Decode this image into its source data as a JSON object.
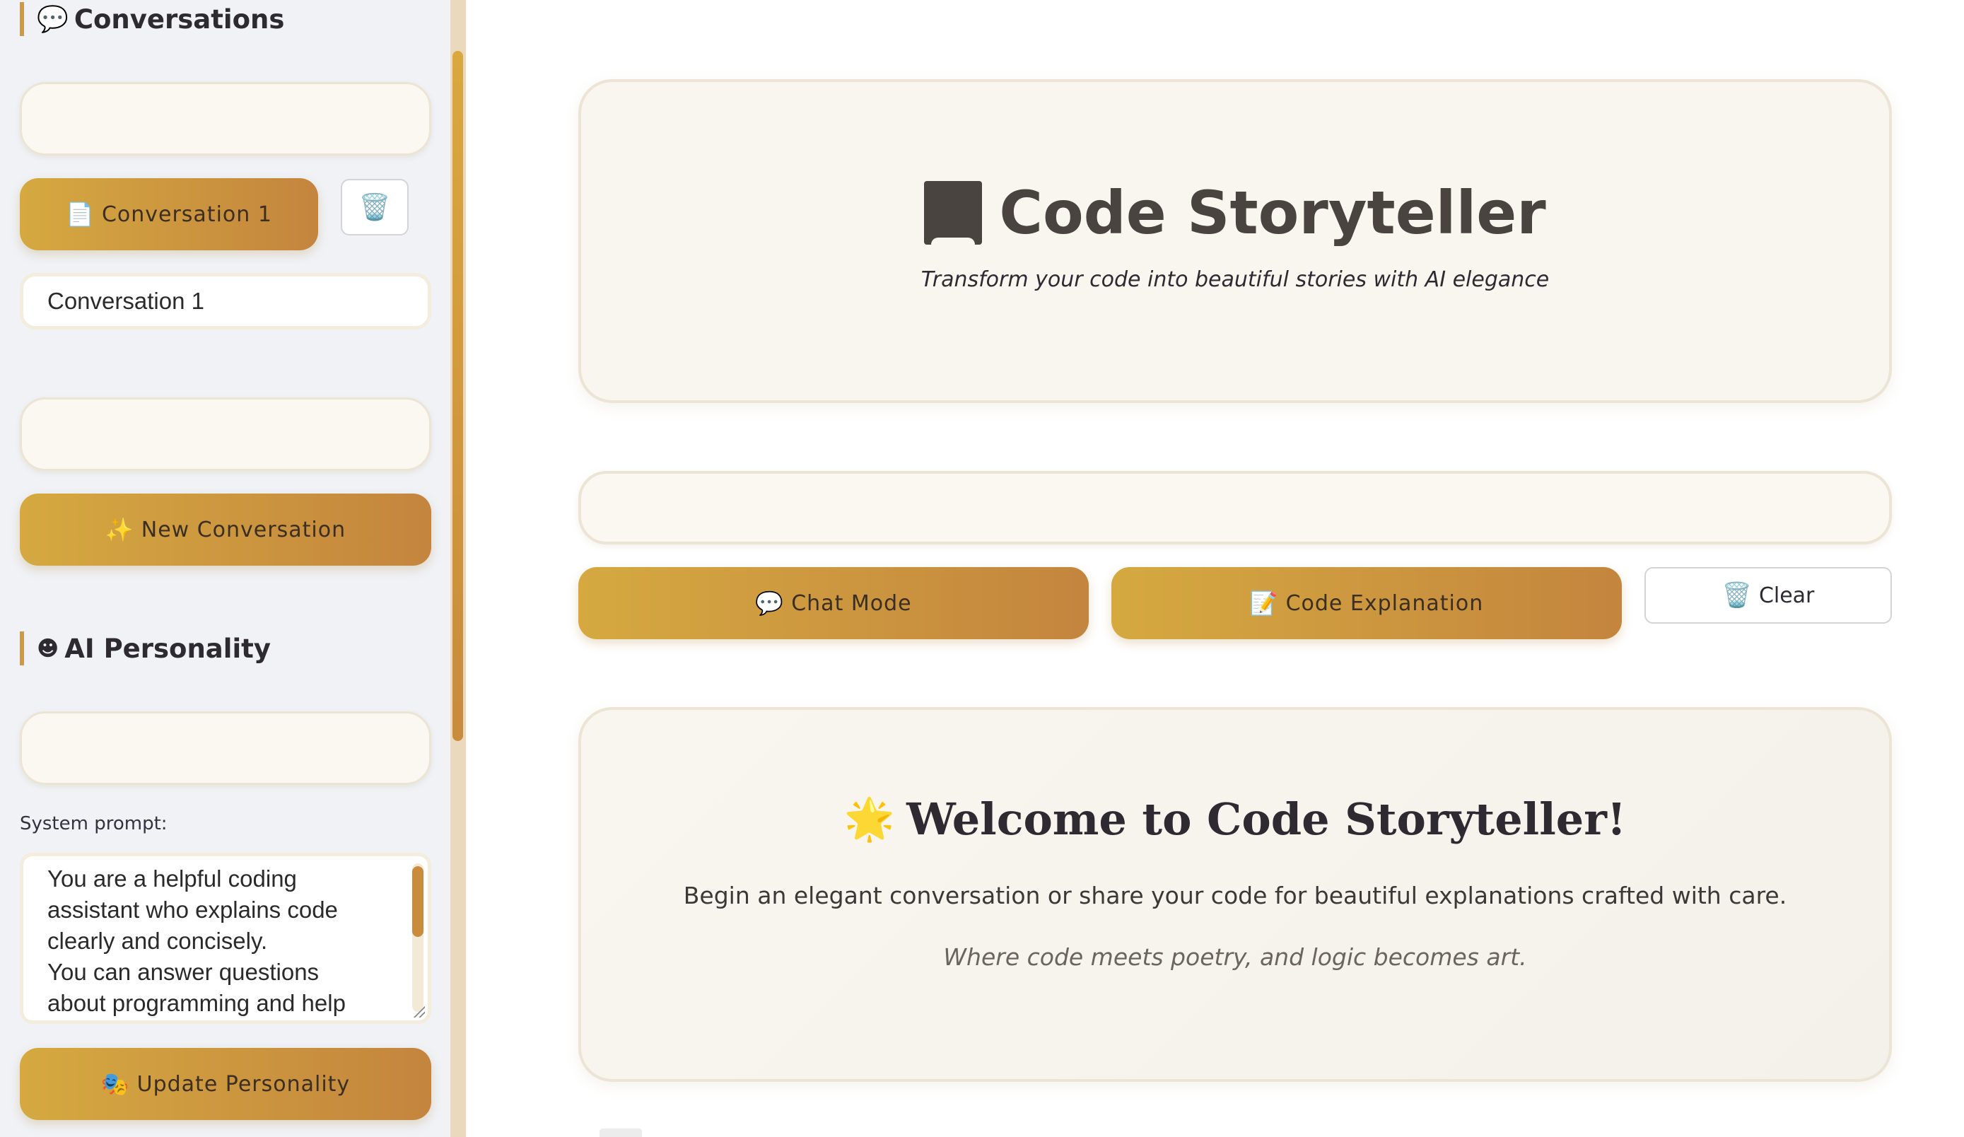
{
  "sidebar": {
    "conversations_heading": {
      "emoji": "💬",
      "label": "Conversations"
    },
    "conversation_item": {
      "emoji": "📄",
      "label": "Conversation 1"
    },
    "delete_icon": "🗑️",
    "rename_value": "Conversation 1",
    "new_conversation": {
      "emoji": "✨",
      "label": "New Conversation"
    },
    "personality_heading": {
      "emoji": "☻",
      "label": "AI Personality"
    },
    "system_prompt_label": "System prompt:",
    "system_prompt_value": "You are a helpful coding\nassistant who explains code\nclearly and concisely.\nYou can answer questions\nabout programming and help",
    "update_personality": {
      "emoji": "🎭",
      "label": "Update Personality"
    }
  },
  "main": {
    "hero": {
      "title": "Code Storyteller",
      "subtitle": "Transform your code into beautiful stories with AI elegance"
    },
    "buttons": {
      "chat_mode": {
        "emoji": "💬",
        "label": "Chat Mode"
      },
      "code_explanation": {
        "emoji": "📝",
        "label": "Code Explanation"
      },
      "clear": {
        "emoji": "🗑️",
        "label": "Clear"
      }
    },
    "welcome": {
      "emoji": "🌟",
      "title": "Welcome to Code Storyteller!",
      "body": "Begin an elegant conversation or share your code for beautiful explanations crafted with care.",
      "tagline": "Where code meets poetry, and logic becomes art."
    }
  },
  "colors": {
    "accent_gradient_start": "#d5a940",
    "accent_gradient_end": "#c4853e",
    "card_background": "#f9f6ef",
    "sidebar_background": "#f0f2f6"
  },
  "icons": [
    "speech-bubble-icon",
    "document-icon",
    "trash-icon",
    "sparkles-icon",
    "face-icon",
    "theater-masks-icon",
    "book-icon",
    "memo-icon",
    "star-icon"
  ]
}
